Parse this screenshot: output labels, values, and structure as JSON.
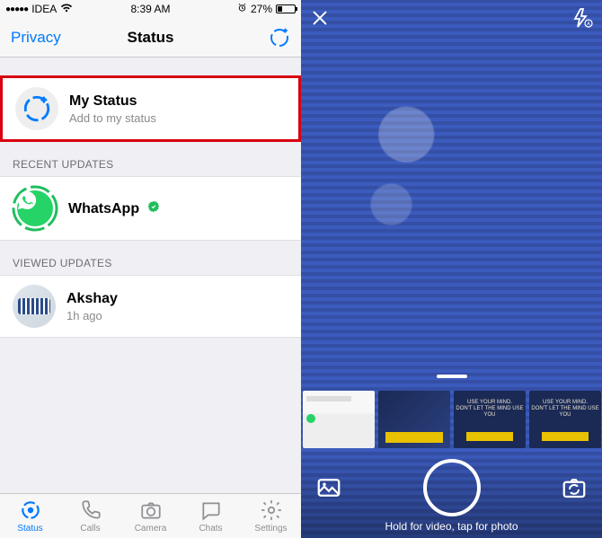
{
  "status_bar": {
    "carrier": "IDEA",
    "time": "8:39 AM",
    "battery_pct": "27%",
    "battery_fill_pct": 27
  },
  "nav": {
    "left": "Privacy",
    "title": "Status"
  },
  "my_status": {
    "title": "My Status",
    "subtitle": "Add to my status"
  },
  "sections": {
    "recent_label": "RECENT UPDATES",
    "viewed_label": "VIEWED UPDATES"
  },
  "recent": [
    {
      "name": "WhatsApp",
      "verified": true
    }
  ],
  "viewed": [
    {
      "name": "Akshay",
      "sub": "1h ago"
    }
  ],
  "tabs": {
    "status": "Status",
    "calls": "Calls",
    "camera": "Camera",
    "chats": "Chats",
    "settings": "Settings",
    "active": "status"
  },
  "camera": {
    "hint": "Hold for video, tap for photo",
    "thumbs": [
      {
        "kind": "status-list"
      },
      {
        "kind": "blue-photo"
      },
      {
        "kind": "quote",
        "line1": "USE YOUR MIND.",
        "line2": "DON'T LET THE MIND USE YOU"
      },
      {
        "kind": "quote",
        "line1": "USE YOUR MIND.",
        "line2": "DON'T LET THE MIND USE YOU"
      }
    ]
  }
}
